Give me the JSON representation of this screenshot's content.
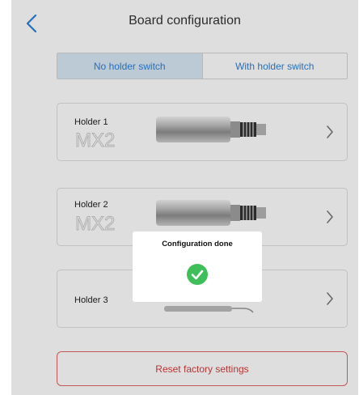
{
  "header": {
    "title": "Board configuration",
    "back_icon": "chevron-left-icon"
  },
  "mode_switch": {
    "options": [
      "No holder switch",
      "With holder switch"
    ],
    "selected": "No holder switch"
  },
  "holders": [
    {
      "label": "Holder 1",
      "model": "MX2",
      "image": "micromotor-mx2",
      "chevron_icon": "chevron-right-icon"
    },
    {
      "label": "Holder 2",
      "model": "MX2",
      "image": "micromotor-mx2",
      "chevron_icon": "chevron-right-icon"
    },
    {
      "label": "Holder 3",
      "image": "scaler-handpiece",
      "chevron_icon": "chevron-right-icon"
    }
  ],
  "reset_button": {
    "label": "Reset factory settings"
  },
  "dialog": {
    "message": "Configuration done",
    "icon": "check-circle-icon"
  },
  "colors": {
    "accent_blue": "#2f7fd4",
    "segment_active_bg": "#d8e8f6",
    "danger_red": "#d63b3b",
    "success_green": "#3fbf5a"
  }
}
